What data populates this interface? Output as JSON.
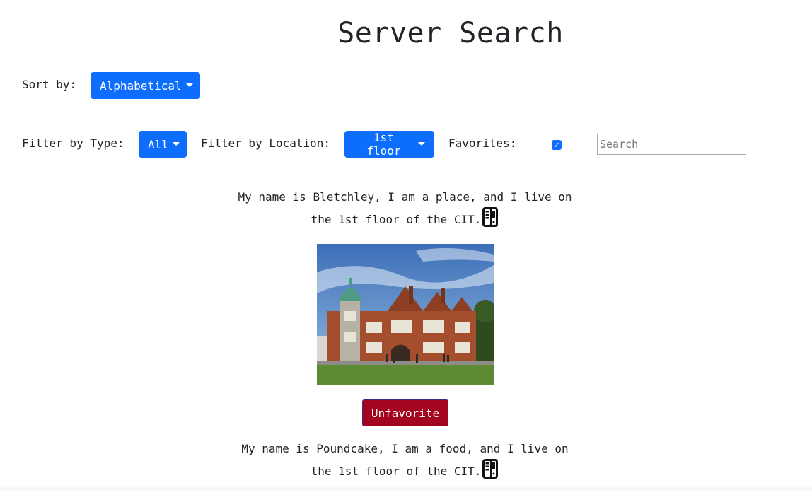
{
  "header": {
    "title": "Server Search"
  },
  "sort": {
    "label": "Sort by:",
    "selected": "Alphabetical"
  },
  "filters": {
    "type_label": "Filter by Type:",
    "type_selected": "All",
    "location_label": "Filter by Location:",
    "location_selected": "1st floor",
    "favorites_label": "Favorites:",
    "favorites_checked": true
  },
  "search": {
    "placeholder": "Search",
    "value": ""
  },
  "servers": [
    {
      "line1": "My name is Bletchley, I am a place, and I live on",
      "line2": "the 1st floor of the CIT.",
      "icon": "server-icon",
      "favorite_button": "Unfavorite"
    },
    {
      "line1": "My name is Poundcake, I am a food, and I live on",
      "line2": "the 1st floor of the CIT.",
      "icon": "server-icon"
    }
  ],
  "colors": {
    "primary": "#0d6efd",
    "unfavorite": "#a3051f"
  }
}
